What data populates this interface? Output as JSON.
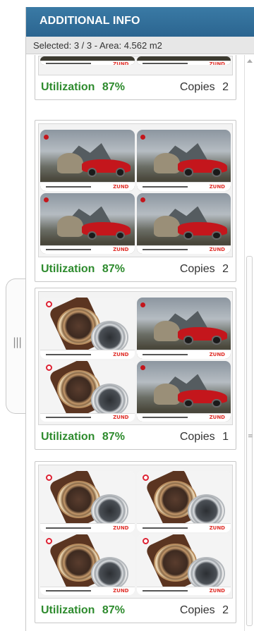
{
  "panel": {
    "title": "ADDITIONAL INFO",
    "selected_label": "Selected:",
    "selected_value": "3 / 3",
    "separator": "-",
    "area_label": "Area:",
    "area_value": "4.562 m2"
  },
  "handle": {
    "grip": "|||"
  },
  "scrollbar": {
    "grip": "≡"
  },
  "cards": [
    {
      "utilization_label": "Utilization",
      "utilization_value": "87%",
      "copies_label": "Copies",
      "copies_value": "2"
    },
    {
      "utilization_label": "Utilization",
      "utilization_value": "87%",
      "copies_label": "Copies",
      "copies_value": "2"
    },
    {
      "utilization_label": "Utilization",
      "utilization_value": "87%",
      "copies_label": "Copies",
      "copies_value": "1"
    },
    {
      "utilization_label": "Utilization",
      "utilization_value": "87%",
      "copies_label": "Copies",
      "copies_value": "2"
    }
  ],
  "tile_brand": "ZUND",
  "colors": {
    "header": "#2f6e98",
    "utilization": "#2e8b2e",
    "car_red": "#c4161c",
    "brand_red": "#e0302a"
  },
  "icons": [
    "collapse-handle-icon",
    "scroll-up-arrow-icon",
    "scroll-grip-icon"
  ]
}
